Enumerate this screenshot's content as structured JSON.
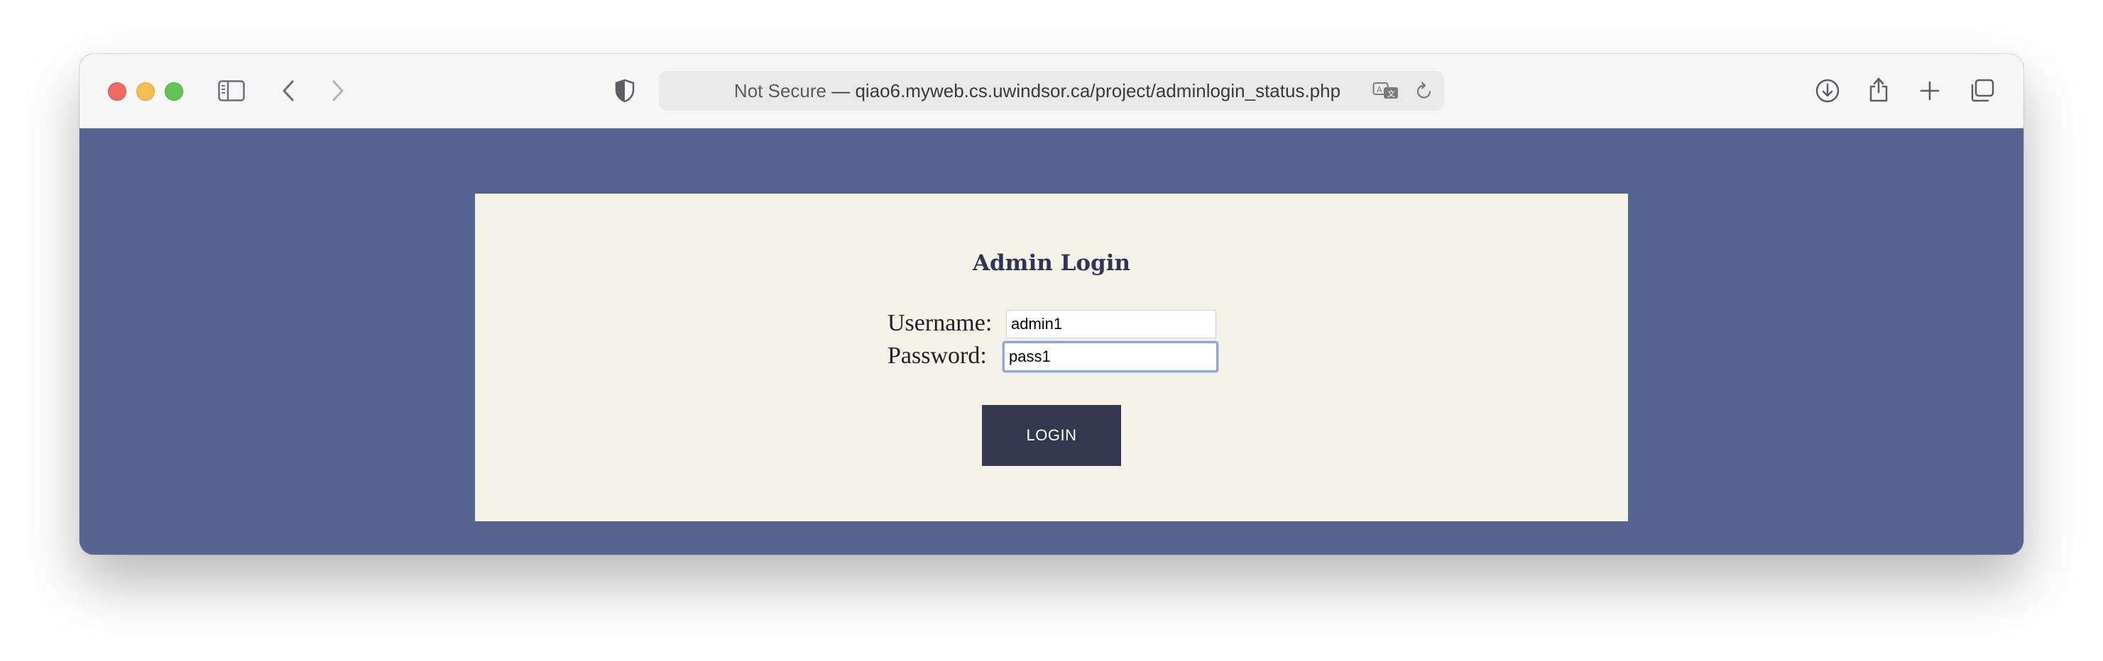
{
  "browser": {
    "address": {
      "security_label": "Not Secure",
      "separator": " — ",
      "url": "qiao6.myweb.cs.uwindsor.ca/project/adminlogin_status.php"
    }
  },
  "page": {
    "title": "Admin Login",
    "username_label": "Username:",
    "username_value": "admin1",
    "password_label": "Password:",
    "password_value": "pass1",
    "login_button": "LOGIN"
  },
  "colors": {
    "page_background": "#566590",
    "panel_background": "#f5f3e8",
    "button_background": "#34384f",
    "focus_ring": "#8fa7d8"
  }
}
